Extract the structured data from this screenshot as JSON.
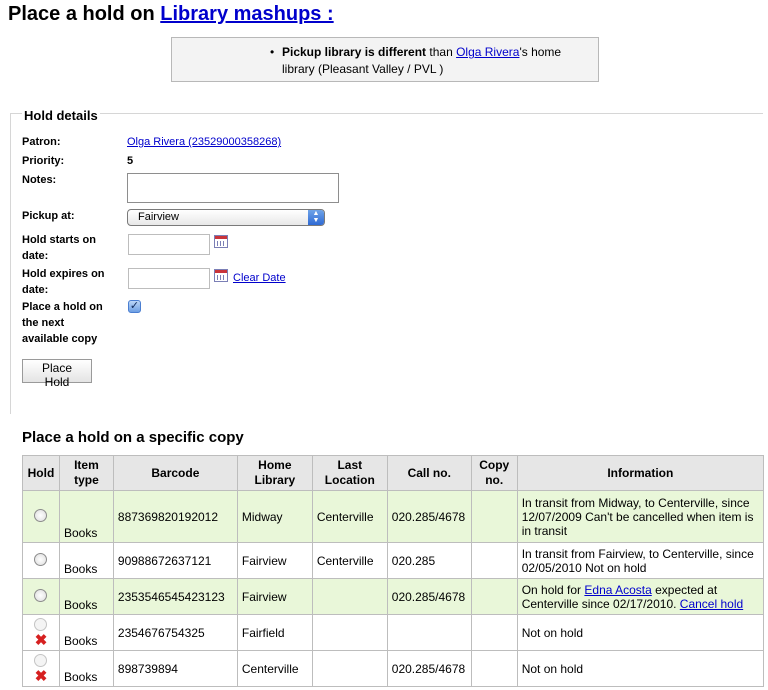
{
  "title": {
    "prefix": "Place a hold on",
    "link": "Library mashups :"
  },
  "message": {
    "bold": "Pickup library is different",
    "than": " than ",
    "patron_link": "Olga Rivera",
    "rest1": "'s home",
    "rest2": "library (Pleasant Valley / PVL )"
  },
  "hold_details": {
    "legend": "Hold details",
    "patron_label": "Patron:",
    "patron_value": "Olga Rivera (23529000358268)",
    "priority_label": "Priority:",
    "priority_value": "5",
    "notes_label": "Notes:",
    "notes_value": "",
    "pickup_label": "Pickup at:",
    "pickup_value": "Fairview",
    "starts_label_1": "Hold starts on",
    "starts_label_2": "date:",
    "expires_label_1": "Hold expires on",
    "expires_label_2": "date:",
    "clear_date": "Clear Date",
    "next_label_1": "Place a hold on",
    "next_label_2": "the next",
    "next_label_3": "available copy",
    "next_checked": true,
    "submit": "Place Hold"
  },
  "specific": {
    "heading": "Place a hold on a specific copy",
    "columns": {
      "hold": "Hold",
      "type_1": "Item",
      "type_2": "type",
      "barcode": "Barcode",
      "home_1": "Home",
      "home_2": "Library",
      "last_1": "Last",
      "last_2": "Location",
      "callno": "Call no.",
      "copy_1": "Copy",
      "copy_2": "no.",
      "info": "Information"
    },
    "rows": [
      {
        "type": "Books",
        "barcode": "887369820192012",
        "home": "Midway",
        "last": "Centerville",
        "callno": "020.285/4678",
        "copy": "",
        "info_1": "In transit from Midway, to Centerville, since",
        "info_2": "12/07/2009 Can't be cancelled when item is",
        "info_3": "in transit"
      },
      {
        "type": "Books",
        "barcode": "90988672637121",
        "home": "Fairview",
        "last": "Centerville",
        "callno": "020.285",
        "copy": "",
        "info_1": "In transit from Fairview, to Centerville, since",
        "info_2": "02/05/2010 Not on hold"
      },
      {
        "type": "Books",
        "barcode": "2353546545423123",
        "home": "Fairview",
        "last": "",
        "callno": "020.285/4678",
        "copy": "",
        "info_pre": "On hold for ",
        "info_link": "Edna Acosta",
        "info_mid": " expected at",
        "info_line2": "Centerville since 02/17/2010. ",
        "info_cancel": "Cancel hold"
      },
      {
        "type": "Books",
        "barcode": "2354676754325",
        "home": "Fairfield",
        "last": "",
        "callno": "",
        "copy": "",
        "info": "Not on hold"
      },
      {
        "type": "Books",
        "barcode": "898739894",
        "home": "Centerville",
        "last": "",
        "callno": "020.285/4678",
        "copy": "",
        "info": "Not on hold"
      }
    ]
  }
}
